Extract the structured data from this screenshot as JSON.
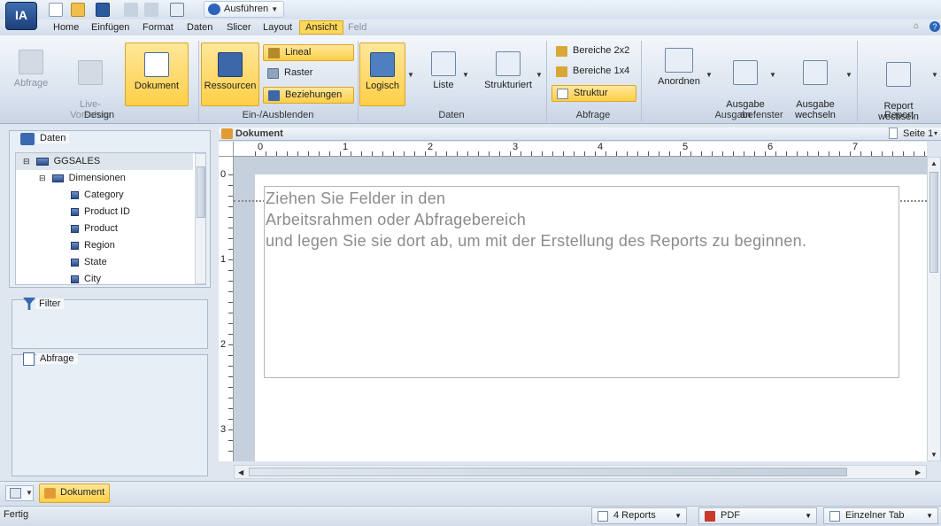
{
  "app_logo": "IA",
  "toolbar": {
    "run_label": "Ausführen"
  },
  "menu": {
    "items": [
      "Home",
      "Einfügen",
      "Format",
      "Daten",
      "Slicer",
      "Layout",
      "Ansicht",
      "Feld"
    ],
    "active": "Ansicht"
  },
  "ribbon": {
    "groups": {
      "design": "Design",
      "show_hide": "Ein-/Ausblenden",
      "data": "Daten",
      "query": "Abfrage",
      "output": "Ausgabefenster",
      "report": "Report"
    },
    "buttons": {
      "abfrage": "Abfrage",
      "live_preview": "Live-\nVorschau",
      "dokument": "Dokument",
      "ressourcen": "Ressourcen",
      "lineal": "Lineal",
      "raster": "Raster",
      "beziehungen": "Beziehungen",
      "logisch": "Logisch",
      "liste": "Liste",
      "strukturiert": "Strukturiert",
      "bereiche_2x2": "Bereiche 2x2",
      "bereiche_1x4": "Bereiche 1x4",
      "struktur": "Struktur",
      "anordnen": "Anordnen",
      "ausgabe_an": "Ausgabe\nan",
      "ausgabe_wechseln": "Ausgabe\nwechseln",
      "report_wechseln": "Report\nwechseln"
    }
  },
  "data_pane": {
    "title": "Daten",
    "root": "GGSALES",
    "folder": "Dimensionen",
    "fields": [
      "Category",
      "Product ID",
      "Product",
      "Region",
      "State",
      "City"
    ]
  },
  "filter_pane": {
    "title": "Filter"
  },
  "query_pane": {
    "title": "Abfrage"
  },
  "document": {
    "title": "Dokument",
    "page_selector": "Seite 1",
    "ruler_h": [
      "0",
      "1",
      "2",
      "3",
      "4",
      "5",
      "6",
      "7"
    ],
    "ruler_v": [
      "0",
      "1",
      "2",
      "3"
    ],
    "drop_text": "Ziehen Sie Felder in den\nArbeitsrahmen oder Abfragebereich\nund legen Sie sie dort ab, um mit der Erstellung des Reports zu beginnen."
  },
  "bottom_tab": {
    "label": "Dokument"
  },
  "status": {
    "text": "Fertig",
    "reports": "4 Reports",
    "format": "PDF",
    "tab_mode": "Einzelner Tab"
  },
  "colors": {
    "accent": "#ffd75a",
    "ribbon_bg": "#d9e2ee",
    "canvas_bg": "#c6d0dc"
  }
}
